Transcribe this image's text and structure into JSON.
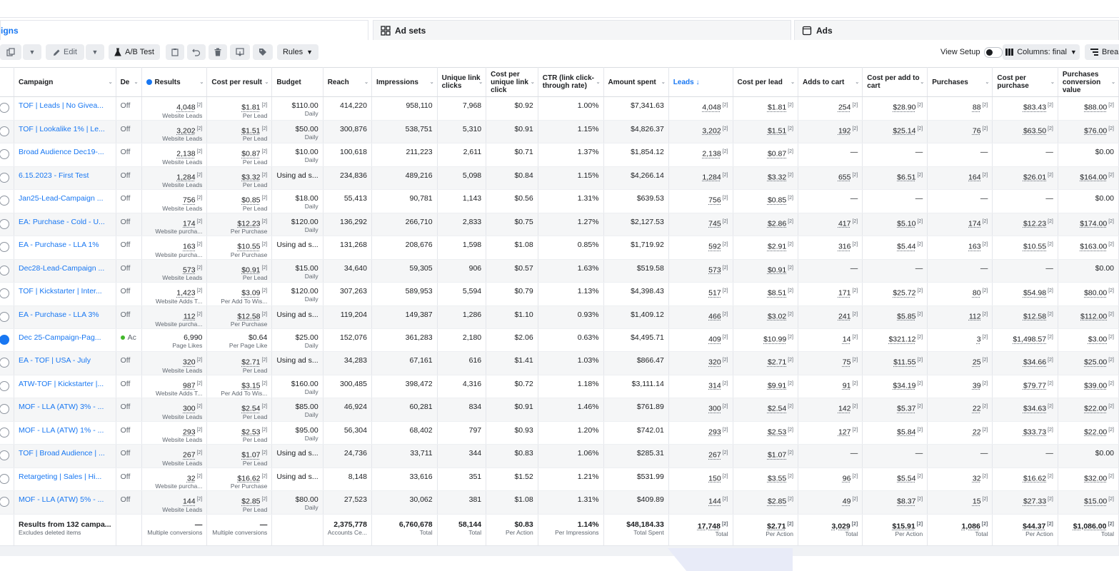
{
  "tabs": {
    "campaigns": "igns",
    "adsets": "Ad sets",
    "ads": "Ads"
  },
  "toolbar": {
    "edit": "Edit",
    "ab_test": "A/B Test",
    "rules": "Rules",
    "view_setup": "View Setup",
    "columns": "Columns: final",
    "breakdown": "Breal"
  },
  "columns": [
    {
      "key": "sel",
      "label": ""
    },
    {
      "key": "campaign",
      "label": "Campaign"
    },
    {
      "key": "delivery",
      "label": "De"
    },
    {
      "key": "results",
      "label": "Results"
    },
    {
      "key": "cpr",
      "label": "Cost per result"
    },
    {
      "key": "budget",
      "label": "Budget"
    },
    {
      "key": "reach",
      "label": "Reach"
    },
    {
      "key": "impressions",
      "label": "Impressions"
    },
    {
      "key": "ulc",
      "label": "Unique link clicks"
    },
    {
      "key": "cpulc",
      "label": "Cost per unique link click"
    },
    {
      "key": "ctr",
      "label": "CTR (link click-through rate)"
    },
    {
      "key": "spent",
      "label": "Amount spent"
    },
    {
      "key": "leads",
      "label": "Leads ↓"
    },
    {
      "key": "cpl",
      "label": "Cost per lead"
    },
    {
      "key": "atc",
      "label": "Adds to cart"
    },
    {
      "key": "cpatc",
      "label": "Cost per add to cart"
    },
    {
      "key": "purchases",
      "label": "Purchases"
    },
    {
      "key": "cpp",
      "label": "Cost per purchase"
    },
    {
      "key": "pcv",
      "label": "Purchases conversion value"
    }
  ],
  "rows": [
    {
      "campaign": "TOF | Leads | No Givea...",
      "delivery": "Off",
      "results": "4,048",
      "results_sub": "Website Leads",
      "cpr": "$1.81",
      "cpr_sub": "Per Lead",
      "budget": "$110.00",
      "budget_sub": "Daily",
      "reach": "414,220",
      "impressions": "958,110",
      "ulc": "7,968",
      "cpulc": "$0.92",
      "ctr": "1.00%",
      "spent": "$7,341.63",
      "leads": "4,048",
      "cpl": "$1.81",
      "atc": "254",
      "cpatc": "$28.90",
      "purchases": "88",
      "cpp": "$83.43",
      "pcv": "$88.00"
    },
    {
      "campaign": "TOF | Lookalike 1% | Le...",
      "delivery": "Off",
      "results": "3,202",
      "results_sub": "Website Leads",
      "cpr": "$1.51",
      "cpr_sub": "Per Lead",
      "budget": "$50.00",
      "budget_sub": "Daily",
      "reach": "300,876",
      "impressions": "538,751",
      "ulc": "5,310",
      "cpulc": "$0.91",
      "ctr": "1.15%",
      "spent": "$4,826.37",
      "leads": "3,202",
      "cpl": "$1.51",
      "atc": "192",
      "cpatc": "$25.14",
      "purchases": "76",
      "cpp": "$63.50",
      "pcv": "$76.00"
    },
    {
      "campaign": "Broad Audience Dec19-...",
      "delivery": "Off",
      "results": "2,138",
      "results_sub": "Website Leads",
      "cpr": "$0.87",
      "cpr_sub": "Per Lead",
      "budget": "$10.00",
      "budget_sub": "Daily",
      "reach": "100,618",
      "impressions": "211,223",
      "ulc": "2,611",
      "cpulc": "$0.71",
      "ctr": "1.37%",
      "spent": "$1,854.12",
      "leads": "2,138",
      "cpl": "$0.87",
      "atc": "—",
      "cpatc": "—",
      "purchases": "—",
      "cpp": "—",
      "pcv": "$0.00"
    },
    {
      "campaign": "6.15.2023 - First Test",
      "delivery": "Off",
      "results": "1,284",
      "results_sub": "Website Leads",
      "cpr": "$3.32",
      "cpr_sub": "Per Lead",
      "budget": "Using ad s...",
      "budget_sub": "",
      "reach": "234,836",
      "impressions": "489,216",
      "ulc": "5,098",
      "cpulc": "$0.84",
      "ctr": "1.15%",
      "spent": "$4,266.14",
      "leads": "1,284",
      "cpl": "$3.32",
      "atc": "655",
      "cpatc": "$6.51",
      "purchases": "164",
      "cpp": "$26.01",
      "pcv": "$164.00"
    },
    {
      "campaign": "Jan25-Lead-Campaign ...",
      "delivery": "Off",
      "results": "756",
      "results_sub": "Website Leads",
      "cpr": "$0.85",
      "cpr_sub": "Per Lead",
      "budget": "$18.00",
      "budget_sub": "Daily",
      "reach": "55,413",
      "impressions": "90,781",
      "ulc": "1,143",
      "cpulc": "$0.56",
      "ctr": "1.31%",
      "spent": "$639.53",
      "leads": "756",
      "cpl": "$0.85",
      "atc": "—",
      "cpatc": "—",
      "purchases": "—",
      "cpp": "—",
      "pcv": "$0.00"
    },
    {
      "campaign": "EA: Purchase - Cold - U...",
      "delivery": "Off",
      "results": "174",
      "results_sub": "Website purcha...",
      "cpr": "$12.23",
      "cpr_sub": "Per Purchase",
      "budget": "$120.00",
      "budget_sub": "Daily",
      "reach": "136,292",
      "impressions": "266,710",
      "ulc": "2,833",
      "cpulc": "$0.75",
      "ctr": "1.27%",
      "spent": "$2,127.53",
      "leads": "745",
      "cpl": "$2.86",
      "atc": "417",
      "cpatc": "$5.10",
      "purchases": "174",
      "cpp": "$12.23",
      "pcv": "$174.00"
    },
    {
      "campaign": "EA - Purchase - LLA 1%",
      "delivery": "Off",
      "results": "163",
      "results_sub": "Website purcha...",
      "cpr": "$10.55",
      "cpr_sub": "Per Purchase",
      "budget": "Using ad s...",
      "budget_sub": "",
      "reach": "131,268",
      "impressions": "208,676",
      "ulc": "1,598",
      "cpulc": "$1.08",
      "ctr": "0.85%",
      "spent": "$1,719.92",
      "leads": "592",
      "cpl": "$2.91",
      "atc": "316",
      "cpatc": "$5.44",
      "purchases": "163",
      "cpp": "$10.55",
      "pcv": "$163.00"
    },
    {
      "campaign": "Dec28-Lead-Campaign ...",
      "delivery": "Off",
      "results": "573",
      "results_sub": "Website Leads",
      "cpr": "$0.91",
      "cpr_sub": "Per Lead",
      "budget": "$15.00",
      "budget_sub": "Daily",
      "reach": "34,640",
      "impressions": "59,305",
      "ulc": "906",
      "cpulc": "$0.57",
      "ctr": "1.63%",
      "spent": "$519.58",
      "leads": "573",
      "cpl": "$0.91",
      "atc": "—",
      "cpatc": "—",
      "purchases": "—",
      "cpp": "—",
      "pcv": "$0.00"
    },
    {
      "campaign": "TOF | Kickstarter | Inter...",
      "delivery": "Off",
      "results": "1,423",
      "results_sub": "Website Adds T...",
      "cpr": "$3.09",
      "cpr_sub": "Per Add To Wis...",
      "budget": "$120.00",
      "budget_sub": "Daily",
      "reach": "307,263",
      "impressions": "589,953",
      "ulc": "5,594",
      "cpulc": "$0.79",
      "ctr": "1.13%",
      "spent": "$4,398.43",
      "leads": "517",
      "cpl": "$8.51",
      "atc": "171",
      "cpatc": "$25.72",
      "purchases": "80",
      "cpp": "$54.98",
      "pcv": "$80.00"
    },
    {
      "campaign": "EA - Purchase - LLA 3%",
      "delivery": "Off",
      "results": "112",
      "results_sub": "Website purcha...",
      "cpr": "$12.58",
      "cpr_sub": "Per Purchase",
      "budget": "Using ad s...",
      "budget_sub": "",
      "reach": "119,204",
      "impressions": "149,387",
      "ulc": "1,286",
      "cpulc": "$1.10",
      "ctr": "0.93%",
      "spent": "$1,409.12",
      "leads": "466",
      "cpl": "$3.02",
      "atc": "241",
      "cpatc": "$5.85",
      "purchases": "112",
      "cpp": "$12.58",
      "pcv": "$112.00"
    },
    {
      "campaign": "Dec 25-Campaign-Pag...",
      "delivery": "Ac",
      "active": true,
      "results": "6,990",
      "results_sub": "Page Likes",
      "cpr": "$0.64",
      "cpr_sub": "Per Page Like",
      "budget": "$25.00",
      "budget_sub": "Daily",
      "reach": "152,076",
      "impressions": "361,283",
      "ulc": "2,180",
      "cpulc": "$2.06",
      "ctr": "0.63%",
      "spent": "$4,495.71",
      "leads": "409",
      "cpl": "$10.99",
      "atc": "14",
      "cpatc": "$321.12",
      "purchases": "3",
      "cpp": "$1,498.57",
      "pcv": "$3.00"
    },
    {
      "campaign": "EA - TOF | USA - July",
      "delivery": "Off",
      "results": "320",
      "results_sub": "Website Leads",
      "cpr": "$2.71",
      "cpr_sub": "Per Lead",
      "budget": "Using ad s...",
      "budget_sub": "",
      "reach": "34,283",
      "impressions": "67,161",
      "ulc": "616",
      "cpulc": "$1.41",
      "ctr": "1.03%",
      "spent": "$866.47",
      "leads": "320",
      "cpl": "$2.71",
      "atc": "75",
      "cpatc": "$11.55",
      "purchases": "25",
      "cpp": "$34.66",
      "pcv": "$25.00"
    },
    {
      "campaign": "ATW-TOF | Kickstarter |...",
      "delivery": "Off",
      "results": "987",
      "results_sub": "Website Adds T...",
      "cpr": "$3.15",
      "cpr_sub": "Per Add To Wis...",
      "budget": "$160.00",
      "budget_sub": "Daily",
      "reach": "300,485",
      "impressions": "398,472",
      "ulc": "4,316",
      "cpulc": "$0.72",
      "ctr": "1.18%",
      "spent": "$3,111.14",
      "leads": "314",
      "cpl": "$9.91",
      "atc": "91",
      "cpatc": "$34.19",
      "purchases": "39",
      "cpp": "$79.77",
      "pcv": "$39.00"
    },
    {
      "campaign": "MOF - LLA (ATW) 3% - ...",
      "delivery": "Off",
      "results": "300",
      "results_sub": "Website Leads",
      "cpr": "$2.54",
      "cpr_sub": "Per Lead",
      "budget": "$85.00",
      "budget_sub": "Daily",
      "reach": "46,924",
      "impressions": "60,281",
      "ulc": "834",
      "cpulc": "$0.91",
      "ctr": "1.46%",
      "spent": "$761.89",
      "leads": "300",
      "cpl": "$2.54",
      "atc": "142",
      "cpatc": "$5.37",
      "purchases": "22",
      "cpp": "$34.63",
      "pcv": "$22.00"
    },
    {
      "campaign": "MOF - LLA (ATW) 1% - ...",
      "delivery": "Off",
      "results": "293",
      "results_sub": "Website Leads",
      "cpr": "$2.53",
      "cpr_sub": "Per Lead",
      "budget": "$95.00",
      "budget_sub": "Daily",
      "reach": "56,304",
      "impressions": "68,402",
      "ulc": "797",
      "cpulc": "$0.93",
      "ctr": "1.20%",
      "spent": "$742.01",
      "leads": "293",
      "cpl": "$2.53",
      "atc": "127",
      "cpatc": "$5.84",
      "purchases": "22",
      "cpp": "$33.73",
      "pcv": "$22.00"
    },
    {
      "campaign": "TOF | Broad Audience | ...",
      "delivery": "Off",
      "results": "267",
      "results_sub": "Website Leads",
      "cpr": "$1.07",
      "cpr_sub": "Per Lead",
      "budget": "Using ad s...",
      "budget_sub": "",
      "reach": "24,736",
      "impressions": "33,711",
      "ulc": "344",
      "cpulc": "$0.83",
      "ctr": "1.06%",
      "spent": "$285.31",
      "leads": "267",
      "cpl": "$1.07",
      "atc": "—",
      "cpatc": "—",
      "purchases": "—",
      "cpp": "—",
      "pcv": "$0.00"
    },
    {
      "campaign": "Retargeting | Sales | Hi...",
      "delivery": "Off",
      "results": "32",
      "results_sub": "Website purcha...",
      "cpr": "$16.62",
      "cpr_sub": "Per Purchase",
      "budget": "Using ad s...",
      "budget_sub": "",
      "reach": "8,148",
      "impressions": "33,616",
      "ulc": "351",
      "cpulc": "$1.52",
      "ctr": "1.21%",
      "spent": "$531.99",
      "leads": "150",
      "cpl": "$3.55",
      "atc": "96",
      "cpatc": "$5.54",
      "purchases": "32",
      "cpp": "$16.62",
      "pcv": "$32.00"
    },
    {
      "campaign": "MOF - LLA (ATW) 5% - ...",
      "delivery": "Off",
      "results": "144",
      "results_sub": "Website Leads",
      "cpr": "$2.85",
      "cpr_sub": "Per Lead",
      "budget": "$80.00",
      "budget_sub": "Daily",
      "reach": "27,523",
      "impressions": "30,062",
      "ulc": "381",
      "cpulc": "$1.08",
      "ctr": "1.31%",
      "spent": "$409.89",
      "leads": "144",
      "cpl": "$2.85",
      "atc": "49",
      "cpatc": "$8.37",
      "purchases": "15",
      "cpp": "$27.33",
      "pcv": "$15.00"
    }
  ],
  "totals": {
    "campaign": "Results from 132 campa...",
    "campaign_sub": "Excludes deleted items",
    "results": "—",
    "results_sub": "Multiple conversions",
    "cpr": "—",
    "cpr_sub": "Multiple conversions",
    "reach": "2,375,778",
    "reach_sub": "Accounts Ce...",
    "impressions": "6,760,678",
    "impressions_sub": "Total",
    "ulc": "58,144",
    "ulc_sub": "Total",
    "cpulc": "$0.83",
    "cpulc_sub": "Per Action",
    "ctr": "1.14%",
    "ctr_sub": "Per Impressions",
    "spent": "$48,184.33",
    "spent_sub": "Total Spent",
    "leads": "17,748",
    "leads_sub": "Total",
    "cpl": "$2.71",
    "cpl_sub": "Per Action",
    "atc": "3,029",
    "atc_sub": "Total",
    "cpatc": "$15.91",
    "cpatc_sub": "Per Action",
    "purchases": "1,086",
    "purchases_sub": "Total",
    "cpp": "$44.37",
    "cpp_sub": "Per Action",
    "pcv": "$1,086.00",
    "pcv_sub": "Total"
  },
  "badge": "[2]",
  "colors": {
    "link": "#1877f2",
    "active_dot": "#42b72a",
    "row_alt": "#f5f6f7"
  }
}
